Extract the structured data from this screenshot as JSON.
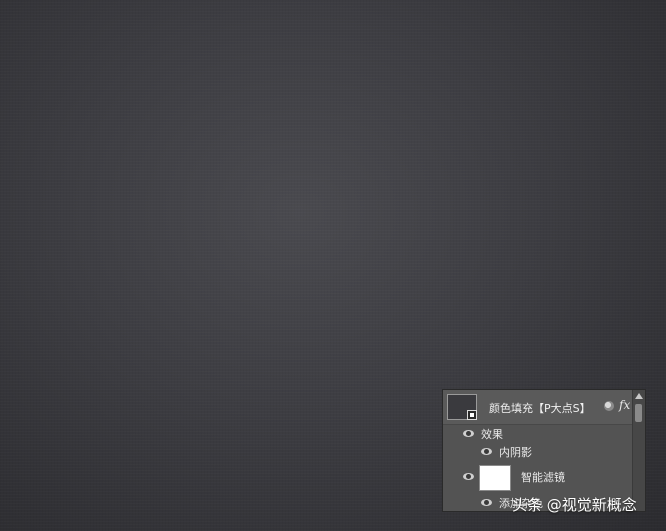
{
  "layers_panel": {
    "layer_name": "颜色填充【P大点S】",
    "fx_label": "fx",
    "effects_label": "效果",
    "inner_shadow_label": "内阴影",
    "smart_filters_label": "智能滤镜",
    "add_noise_label": "添加杂色"
  },
  "watermark": "头条 @视觉新概念",
  "icons": [
    "layer-thumbnail-icon",
    "link-icon",
    "fx-icon",
    "eye-icon",
    "scroll-up-arrow-icon"
  ],
  "colors": {
    "background": "#3d3d42",
    "panel": "#535353",
    "text": "#eaeaea"
  }
}
